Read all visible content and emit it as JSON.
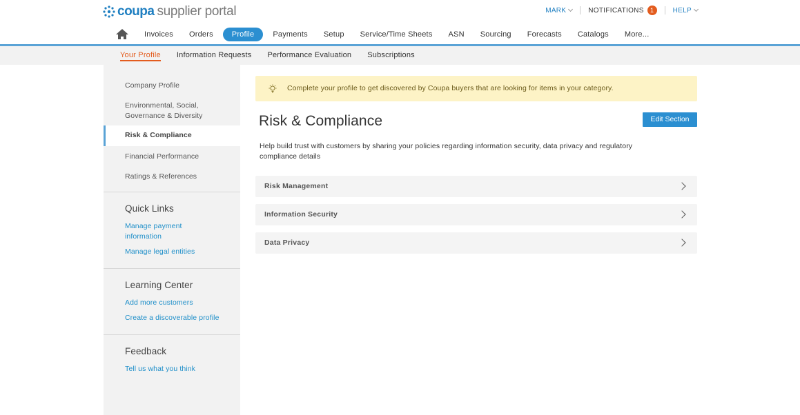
{
  "header": {
    "logo_word": "coupa",
    "logo_rest": "supplier portal",
    "user_label": "MARK",
    "notifications_label": "NOTIFICATIONS",
    "notifications_count": "1",
    "help_label": "HELP"
  },
  "nav": {
    "home_icon": "home-icon",
    "items": [
      {
        "label": "Invoices"
      },
      {
        "label": "Orders"
      },
      {
        "label": "Profile",
        "active": true
      },
      {
        "label": "Payments"
      },
      {
        "label": "Setup"
      },
      {
        "label": "Service/Time Sheets"
      },
      {
        "label": "ASN"
      },
      {
        "label": "Sourcing"
      },
      {
        "label": "Forecasts"
      },
      {
        "label": "Catalogs"
      },
      {
        "label": "More..."
      }
    ]
  },
  "subnav": {
    "items": [
      {
        "label": "Your Profile",
        "active": true
      },
      {
        "label": "Information Requests"
      },
      {
        "label": "Performance Evaluation"
      },
      {
        "label": "Subscriptions"
      }
    ]
  },
  "sidebar": {
    "profile_items": [
      {
        "label": "Company Profile"
      },
      {
        "label": "Environmental, Social, Governance & Diversity"
      },
      {
        "label": "Risk & Compliance",
        "active": true
      },
      {
        "label": "Financial Performance"
      },
      {
        "label": "Ratings & References"
      }
    ],
    "quick_links": {
      "heading": "Quick Links",
      "links": [
        "Manage payment information",
        "Manage legal entities"
      ]
    },
    "learning_center": {
      "heading": "Learning Center",
      "links": [
        "Add more customers",
        "Create a discoverable profile"
      ]
    },
    "feedback": {
      "heading": "Feedback",
      "links": [
        "Tell us what you think"
      ]
    }
  },
  "main": {
    "banner_text": "Complete your profile to get discovered by Coupa buyers that are looking for items in your category.",
    "title": "Risk & Compliance",
    "edit_button": "Edit Section",
    "description": "Help build trust with customers by sharing your policies regarding information security, data privacy and regulatory compliance details",
    "sections": [
      {
        "label": "Risk Management"
      },
      {
        "label": "Information Security"
      },
      {
        "label": "Data Privacy"
      }
    ]
  },
  "colors": {
    "brand_blue": "#2b8fd1",
    "link_blue": "#1f8fc9",
    "accent_orange": "#e35c1e",
    "banner_yellow": "#fdf3c6"
  }
}
